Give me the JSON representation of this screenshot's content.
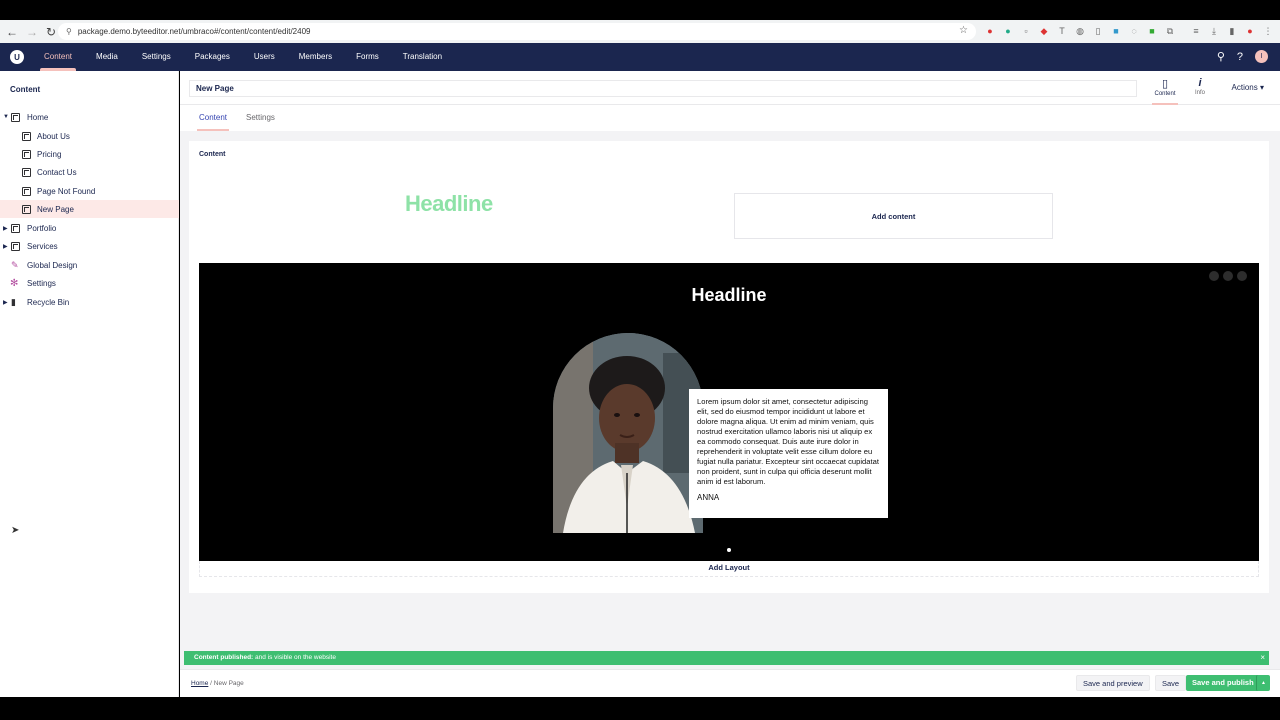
{
  "browser": {
    "url": "package.demo.byteeditor.net/umbraco#/content/content/edit/2409"
  },
  "header": {
    "sections": [
      "Content",
      "Media",
      "Settings",
      "Packages",
      "Users",
      "Members",
      "Forms",
      "Translation"
    ],
    "active_section": "Content",
    "avatar_initial": "I"
  },
  "sidebar": {
    "title": "Content",
    "items": [
      {
        "label": "Home",
        "level": 0,
        "caret": "open"
      },
      {
        "label": "About Us",
        "level": 1
      },
      {
        "label": "Pricing",
        "level": 1
      },
      {
        "label": "Contact Us",
        "level": 1
      },
      {
        "label": "Page Not Found",
        "level": 1
      },
      {
        "label": "New Page",
        "level": 1,
        "selected": true
      },
      {
        "label": "Portfolio",
        "level": 0,
        "caret": "closed"
      },
      {
        "label": "Services",
        "level": 0,
        "caret": "closed"
      },
      {
        "label": "Global Design",
        "level": 0
      },
      {
        "label": "Settings",
        "level": 0
      },
      {
        "label": "Recycle Bin",
        "level": 0,
        "caret": "closed"
      }
    ]
  },
  "editor": {
    "page_name": "New Page",
    "apps": [
      {
        "label": "Content",
        "icon": "document-icon"
      },
      {
        "label": "Info",
        "icon": "info-icon"
      }
    ],
    "actions_label": "Actions ▾",
    "tabs": [
      "Content",
      "Settings"
    ],
    "panel_title": "Content",
    "block1": {
      "headline": "Headline",
      "add_content": "Add content"
    },
    "block2": {
      "headline": "Headline",
      "quote_text": "Lorem ipsum dolor sit amet, consectetur adipiscing elit, sed do eiusmod tempor incididunt ut labore et dolore magna aliqua. Ut enim ad minim veniam, quis nostrud exercitation ullamco laboris nisi ut aliquip ex ea commodo consequat. Duis aute irure dolor in reprehenderit in voluptate velit esse cillum dolore eu fugiat nulla pariatur. Excepteur sint occaecat cupidatat non proident, sunt in culpa qui officia deserunt mollit anim id est laborum.",
      "quote_name": "ANNA"
    },
    "add_layout": "Add Layout"
  },
  "notification": {
    "bold": "Content published:",
    "text": " and is visible on the website",
    "close": "×"
  },
  "footer": {
    "breadcrumb_home": "Home",
    "breadcrumb_sep": "/",
    "breadcrumb_current": "New Page",
    "save_preview": "Save and preview",
    "save": "Save",
    "save_publish": "Save and publish",
    "more": "▲"
  },
  "colors": {
    "header_bg": "#1b264f",
    "accent_pink": "#f5c1bc",
    "success_green": "#3ebe71",
    "headline_green": "#8ee2a7"
  }
}
